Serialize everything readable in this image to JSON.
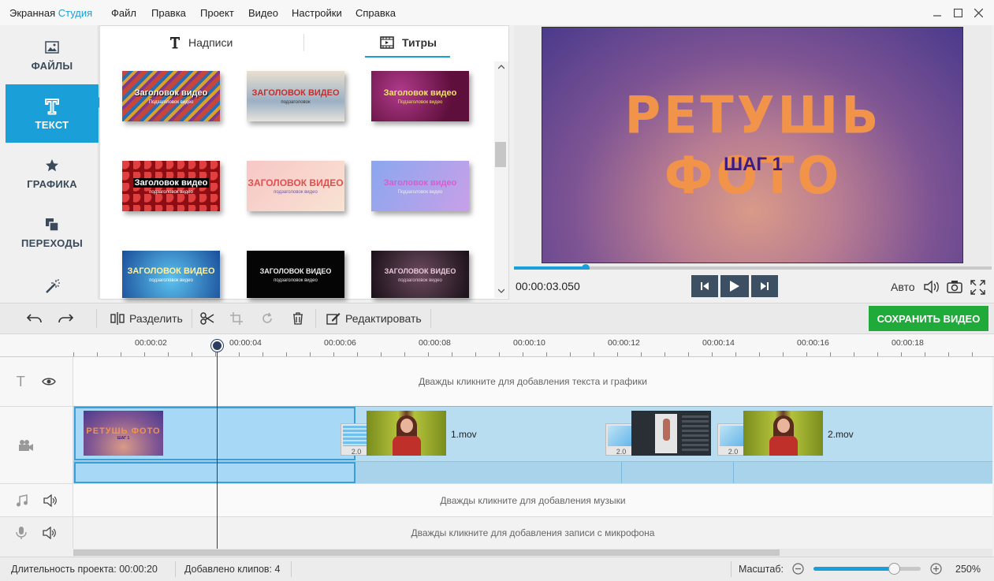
{
  "app": {
    "title_main": "Экранная ",
    "title_accent": "Студия"
  },
  "menu": [
    "Файл",
    "Правка",
    "Проект",
    "Видео",
    "Настройки",
    "Справка"
  ],
  "left_tabs": [
    {
      "label": "ФАЙЛЫ",
      "icon": "image-icon"
    },
    {
      "label": "ТЕКСТ",
      "icon": "text-t-icon"
    },
    {
      "label": "ГРАФИКА",
      "icon": "star-icon"
    },
    {
      "label": "ПЕРЕХОДЫ",
      "icon": "transitions-icon"
    },
    {
      "label": "",
      "icon": "magic-wand-icon"
    }
  ],
  "sub_tabs": {
    "captions": "Надписи",
    "titles": "Титры"
  },
  "thumbs": [
    {
      "t1": "Заголовок видео",
      "t2": "Подзаголовок видео"
    },
    {
      "t1": "ЗАГОЛОВОК ВИДЕО",
      "t2": "подзаголовок"
    },
    {
      "t1": "Заголовок видео",
      "t2": "Подзаголовок видео"
    },
    {
      "t1": "Заголовок видео",
      "t2": "подзаголовок видео"
    },
    {
      "t1": "ЗАГОЛОВОК ВИДЕО",
      "t2": "подзаголовок видео"
    },
    {
      "t1": "Заголовок видео",
      "t2": "Подзаголовок видео"
    },
    {
      "t1": "ЗАГОЛОВОК ВИДЕО",
      "t2": "подзаголовок видео"
    },
    {
      "t1": "ЗАГОЛОВОК ВИДЕО",
      "t2": "подзаголовок видео"
    },
    {
      "t1": "ЗАГОЛОВОК ВИДЕО",
      "t2": "подзаголовок видео"
    }
  ],
  "preview": {
    "title": "РЕТУШЬ ФОТО",
    "subtitle": "ШАГ 1",
    "time": "00:00:03.050",
    "progress": 0.15,
    "auto": "Авто"
  },
  "toolbar": {
    "split": "Разделить",
    "edit": "Редактировать",
    "save": "СОХРАНИТЬ ВИДЕО"
  },
  "ruler": [
    "00:00:02",
    "00:00:04",
    "00:00:06",
    "00:00:08",
    "00:00:10",
    "00:00:12",
    "00:00:14",
    "00:00:16",
    "00:00:18"
  ],
  "timeline": {
    "text_hint": "Дважды кликните для добавления текста и графики",
    "music_hint": "Дважды кликните для добавления музыки",
    "mic_hint": "Дважды кликните для добавления записи с микрофона",
    "clip_title_text": "РЕТУШЬ ФОТО",
    "clip_title_sub": "ШАГ 1",
    "clip1": "1.mov",
    "clip2": "2.mov",
    "trans": "2.0"
  },
  "status": {
    "duration_label": "Длительность проекта:",
    "duration": "00:00:20",
    "clips_label": "Добавлено клипов:",
    "clips": "4",
    "zoom_label": "Масштаб:",
    "zoom": "250%",
    "zoom_level": 0.75
  },
  "colors": {
    "accent": "#1a9fd8",
    "save": "#1faa3a",
    "play_btn": "#3d4f63"
  }
}
